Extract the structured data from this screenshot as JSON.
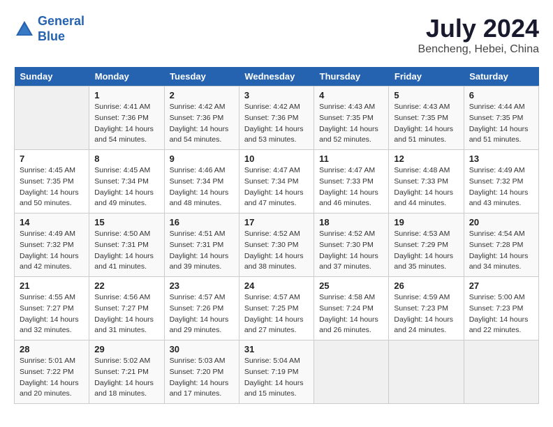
{
  "logo": {
    "line1": "General",
    "line2": "Blue"
  },
  "title": "July 2024",
  "subtitle": "Bencheng, Hebei, China",
  "header_days": [
    "Sunday",
    "Monday",
    "Tuesday",
    "Wednesday",
    "Thursday",
    "Friday",
    "Saturday"
  ],
  "weeks": [
    [
      {
        "day": "",
        "sunrise": "",
        "sunset": "",
        "daylight": ""
      },
      {
        "day": "1",
        "sunrise": "4:41 AM",
        "sunset": "7:36 PM",
        "daylight": "14 hours and 54 minutes."
      },
      {
        "day": "2",
        "sunrise": "4:42 AM",
        "sunset": "7:36 PM",
        "daylight": "14 hours and 54 minutes."
      },
      {
        "day": "3",
        "sunrise": "4:42 AM",
        "sunset": "7:36 PM",
        "daylight": "14 hours and 53 minutes."
      },
      {
        "day": "4",
        "sunrise": "4:43 AM",
        "sunset": "7:35 PM",
        "daylight": "14 hours and 52 minutes."
      },
      {
        "day": "5",
        "sunrise": "4:43 AM",
        "sunset": "7:35 PM",
        "daylight": "14 hours and 51 minutes."
      },
      {
        "day": "6",
        "sunrise": "4:44 AM",
        "sunset": "7:35 PM",
        "daylight": "14 hours and 51 minutes."
      }
    ],
    [
      {
        "day": "7",
        "sunrise": "4:45 AM",
        "sunset": "7:35 PM",
        "daylight": "14 hours and 50 minutes."
      },
      {
        "day": "8",
        "sunrise": "4:45 AM",
        "sunset": "7:34 PM",
        "daylight": "14 hours and 49 minutes."
      },
      {
        "day": "9",
        "sunrise": "4:46 AM",
        "sunset": "7:34 PM",
        "daylight": "14 hours and 48 minutes."
      },
      {
        "day": "10",
        "sunrise": "4:47 AM",
        "sunset": "7:34 PM",
        "daylight": "14 hours and 47 minutes."
      },
      {
        "day": "11",
        "sunrise": "4:47 AM",
        "sunset": "7:33 PM",
        "daylight": "14 hours and 46 minutes."
      },
      {
        "day": "12",
        "sunrise": "4:48 AM",
        "sunset": "7:33 PM",
        "daylight": "14 hours and 44 minutes."
      },
      {
        "day": "13",
        "sunrise": "4:49 AM",
        "sunset": "7:32 PM",
        "daylight": "14 hours and 43 minutes."
      }
    ],
    [
      {
        "day": "14",
        "sunrise": "4:49 AM",
        "sunset": "7:32 PM",
        "daylight": "14 hours and 42 minutes."
      },
      {
        "day": "15",
        "sunrise": "4:50 AM",
        "sunset": "7:31 PM",
        "daylight": "14 hours and 41 minutes."
      },
      {
        "day": "16",
        "sunrise": "4:51 AM",
        "sunset": "7:31 PM",
        "daylight": "14 hours and 39 minutes."
      },
      {
        "day": "17",
        "sunrise": "4:52 AM",
        "sunset": "7:30 PM",
        "daylight": "14 hours and 38 minutes."
      },
      {
        "day": "18",
        "sunrise": "4:52 AM",
        "sunset": "7:30 PM",
        "daylight": "14 hours and 37 minutes."
      },
      {
        "day": "19",
        "sunrise": "4:53 AM",
        "sunset": "7:29 PM",
        "daylight": "14 hours and 35 minutes."
      },
      {
        "day": "20",
        "sunrise": "4:54 AM",
        "sunset": "7:28 PM",
        "daylight": "14 hours and 34 minutes."
      }
    ],
    [
      {
        "day": "21",
        "sunrise": "4:55 AM",
        "sunset": "7:27 PM",
        "daylight": "14 hours and 32 minutes."
      },
      {
        "day": "22",
        "sunrise": "4:56 AM",
        "sunset": "7:27 PM",
        "daylight": "14 hours and 31 minutes."
      },
      {
        "day": "23",
        "sunrise": "4:57 AM",
        "sunset": "7:26 PM",
        "daylight": "14 hours and 29 minutes."
      },
      {
        "day": "24",
        "sunrise": "4:57 AM",
        "sunset": "7:25 PM",
        "daylight": "14 hours and 27 minutes."
      },
      {
        "day": "25",
        "sunrise": "4:58 AM",
        "sunset": "7:24 PM",
        "daylight": "14 hours and 26 minutes."
      },
      {
        "day": "26",
        "sunrise": "4:59 AM",
        "sunset": "7:23 PM",
        "daylight": "14 hours and 24 minutes."
      },
      {
        "day": "27",
        "sunrise": "5:00 AM",
        "sunset": "7:23 PM",
        "daylight": "14 hours and 22 minutes."
      }
    ],
    [
      {
        "day": "28",
        "sunrise": "5:01 AM",
        "sunset": "7:22 PM",
        "daylight": "14 hours and 20 minutes."
      },
      {
        "day": "29",
        "sunrise": "5:02 AM",
        "sunset": "7:21 PM",
        "daylight": "14 hours and 18 minutes."
      },
      {
        "day": "30",
        "sunrise": "5:03 AM",
        "sunset": "7:20 PM",
        "daylight": "14 hours and 17 minutes."
      },
      {
        "day": "31",
        "sunrise": "5:04 AM",
        "sunset": "7:19 PM",
        "daylight": "14 hours and 15 minutes."
      },
      {
        "day": "",
        "sunrise": "",
        "sunset": "",
        "daylight": ""
      },
      {
        "day": "",
        "sunrise": "",
        "sunset": "",
        "daylight": ""
      },
      {
        "day": "",
        "sunrise": "",
        "sunset": "",
        "daylight": ""
      }
    ]
  ],
  "labels": {
    "sunrise_prefix": "Sunrise: ",
    "sunset_prefix": "Sunset: ",
    "daylight_prefix": "Daylight: "
  }
}
